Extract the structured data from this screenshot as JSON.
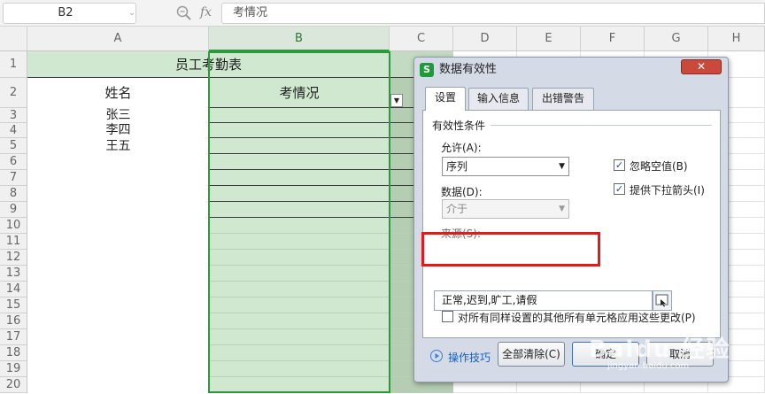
{
  "formula_bar": {
    "name_box": "B2",
    "fx_symbol": "fx",
    "formula": "考情况"
  },
  "columns": [
    "A",
    "B",
    "C",
    "D",
    "E",
    "F",
    "G",
    "H"
  ],
  "rows": [
    "1",
    "2",
    "3",
    "4",
    "5",
    "6",
    "7",
    "8",
    "9",
    "10",
    "11",
    "12",
    "13",
    "14",
    "15",
    "16",
    "17",
    "18",
    "19",
    "20"
  ],
  "table": {
    "title": "员工考勤表",
    "header_name": "姓名",
    "header_status": "考情况",
    "names": [
      "张三",
      "李四",
      "王五"
    ]
  },
  "dialog": {
    "title": "数据有效性",
    "close_symbol": "✕",
    "tabs": [
      "设置",
      "输入信息",
      "出错警告"
    ],
    "group_label": "有效性条件",
    "allow_label": "允许(A):",
    "allow_value": "序列",
    "data_label": "数据(D):",
    "data_value": "介于",
    "ignore_blank_label": "忽略空值(B)",
    "ignore_blank_checked": true,
    "dropdown_label": "提供下拉箭头(I)",
    "dropdown_checked": true,
    "source_label": "来源(S):",
    "source_value": "正常,迟到,旷工,请假",
    "apply_all_label": "对所有同样设置的其他所有单元格应用这些更改(P)",
    "apply_all_checked": false,
    "tips_label": "操作技巧",
    "clear_all_button": "全部清除(C)",
    "ok_button": "确定",
    "cancel_button": "取消"
  },
  "watermark": {
    "text": "Baidu 经验",
    "sub": "jingyan.baidu.com"
  },
  "colors": {
    "sheet_fill": "#cfe8cf",
    "selected_fill": "#b5cdb2",
    "selection_border": "#2a9a3a",
    "highlight_border": "#e01b1b"
  }
}
